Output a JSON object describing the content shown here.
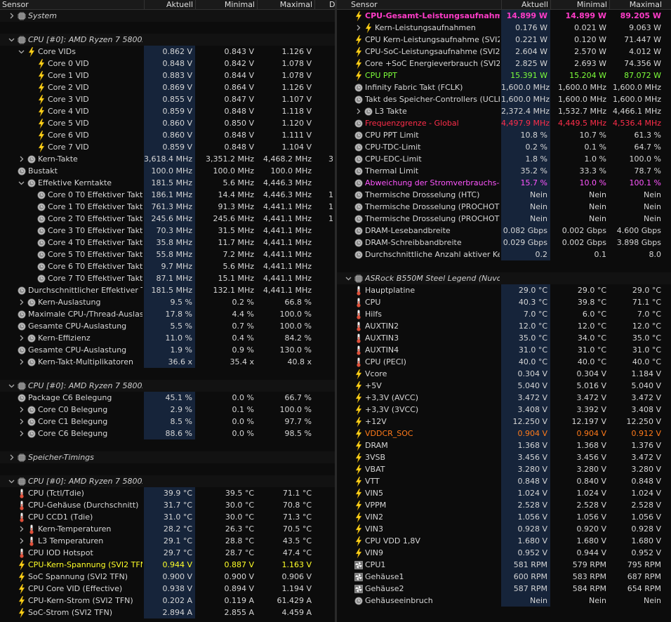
{
  "header": {
    "sensor": "Sensor",
    "current": "Aktuell",
    "min": "Minimal",
    "max": "Maximal",
    "avg": "D"
  },
  "left": [
    {
      "t": "grp",
      "exp": ">",
      "icon": "chip",
      "label": "System"
    },
    {
      "t": "blank"
    },
    {
      "t": "grp",
      "exp": "v",
      "icon": "chip",
      "label": "CPU [#0]: AMD Ryzen 7 5800X3D"
    },
    {
      "lvl": 1,
      "exp": "v",
      "icon": "bolt",
      "label": "Core VIDs",
      "v": [
        "0.862 V",
        "0.843 V",
        "1.126 V"
      ]
    },
    {
      "lvl": 2,
      "icon": "bolt",
      "label": "Core 0 VID",
      "v": [
        "0.848 V",
        "0.842 V",
        "1.078 V"
      ]
    },
    {
      "lvl": 2,
      "icon": "bolt",
      "label": "Core 1 VID",
      "v": [
        "0.883 V",
        "0.844 V",
        "1.078 V"
      ]
    },
    {
      "lvl": 2,
      "icon": "bolt",
      "label": "Core 2 VID",
      "v": [
        "0.869 V",
        "0.864 V",
        "1.126 V"
      ]
    },
    {
      "lvl": 2,
      "icon": "bolt",
      "label": "Core 3 VID",
      "v": [
        "0.855 V",
        "0.847 V",
        "1.107 V"
      ]
    },
    {
      "lvl": 2,
      "icon": "bolt",
      "label": "Core 4 VID",
      "v": [
        "0.859 V",
        "0.848 V",
        "1.118 V"
      ]
    },
    {
      "lvl": 2,
      "icon": "bolt",
      "label": "Core 5 VID",
      "v": [
        "0.860 V",
        "0.850 V",
        "1.120 V"
      ]
    },
    {
      "lvl": 2,
      "icon": "bolt",
      "label": "Core 6 VID",
      "v": [
        "0.860 V",
        "0.848 V",
        "1.111 V"
      ]
    },
    {
      "lvl": 2,
      "icon": "bolt",
      "label": "Core 7 VID",
      "v": [
        "0.859 V",
        "0.848 V",
        "1.104 V"
      ]
    },
    {
      "lvl": 1,
      "exp": ">",
      "icon": "clock",
      "label": "Kern-Takte",
      "v": [
        "3,618.4 MHz",
        "3,351.2 MHz",
        "4,468.2 MHz"
      ],
      "avg": "3"
    },
    {
      "lvl": 0,
      "icon": "clock",
      "label": "Bustakt",
      "v": [
        "100.0 MHz",
        "100.0 MHz",
        "100.0 MHz"
      ]
    },
    {
      "lvl": 1,
      "exp": "v",
      "icon": "clock",
      "label": "Effektive Kerntakte",
      "v": [
        "181.5 MHz",
        "5.6 MHz",
        "4,446.3 MHz"
      ]
    },
    {
      "lvl": 2,
      "icon": "clock",
      "label": "Core 0 T0 Effektiver Takt",
      "v": [
        "186.1 MHz",
        "14.4 MHz",
        "4,446.3 MHz"
      ],
      "avg": "1"
    },
    {
      "lvl": 2,
      "icon": "clock",
      "label": "Core 1 T0 Effektiver Takt",
      "v": [
        "761.3 MHz",
        "91.3 MHz",
        "4,441.1 MHz"
      ],
      "avg": "1"
    },
    {
      "lvl": 2,
      "icon": "clock",
      "label": "Core 2 T0 Effektiver Takt",
      "v": [
        "245.6 MHz",
        "245.6 MHz",
        "4,441.1 MHz"
      ],
      "avg": "1"
    },
    {
      "lvl": 2,
      "icon": "clock",
      "label": "Core 3 T0 Effektiver Takt",
      "v": [
        "70.3 MHz",
        "31.5 MHz",
        "4,441.1 MHz"
      ]
    },
    {
      "lvl": 2,
      "icon": "clock",
      "label": "Core 4 T0 Effektiver Takt",
      "v": [
        "35.8 MHz",
        "11.7 MHz",
        "4,441.1 MHz"
      ]
    },
    {
      "lvl": 2,
      "icon": "clock",
      "label": "Core 5 T0 Effektiver Takt",
      "v": [
        "55.8 MHz",
        "7.2 MHz",
        "4,441.1 MHz"
      ]
    },
    {
      "lvl": 2,
      "icon": "clock",
      "label": "Core 6 T0 Effektiver Takt",
      "v": [
        "9.7 MHz",
        "5.6 MHz",
        "4,441.1 MHz"
      ]
    },
    {
      "lvl": 2,
      "icon": "clock",
      "label": "Core 7 T0 Effektiver Takt",
      "v": [
        "87.1 MHz",
        "15.1 MHz",
        "4,441.1 MHz"
      ]
    },
    {
      "lvl": 0,
      "icon": "clock",
      "label": "Durchschnittlicher Effektiver Takt",
      "v": [
        "181.5 MHz",
        "132.1 MHz",
        "4,441.1 MHz"
      ]
    },
    {
      "lvl": 1,
      "exp": ">",
      "icon": "clock",
      "label": "Kern-Auslastung",
      "v": [
        "9.5 %",
        "0.2 %",
        "66.8 %"
      ]
    },
    {
      "lvl": 0,
      "icon": "clock",
      "label": "Maximale CPU-/Thread-Auslast...",
      "v": [
        "17.8 %",
        "4.4 %",
        "100.0 %"
      ]
    },
    {
      "lvl": 0,
      "icon": "clock",
      "label": "Gesamte CPU-Auslastung",
      "v": [
        "5.5 %",
        "0.7 %",
        "100.0 %"
      ]
    },
    {
      "lvl": 1,
      "exp": ">",
      "icon": "clock",
      "label": "Kern-Effizienz",
      "v": [
        "11.0 %",
        "0.4 %",
        "84.2 %"
      ]
    },
    {
      "lvl": 0,
      "icon": "clock",
      "label": "Gesamte CPU-Auslastung",
      "v": [
        "1.9 %",
        "0.9 %",
        "130.0 %"
      ]
    },
    {
      "lvl": 1,
      "exp": ">",
      "icon": "clock",
      "label": "Kern-Takt-Multiplikatoren",
      "v": [
        "36.6 x",
        "35.4 x",
        "40.8 x"
      ]
    },
    {
      "t": "blank"
    },
    {
      "t": "grp",
      "exp": "v",
      "icon": "chip",
      "label": "CPU [#0]: AMD Ryzen 7 5800X..."
    },
    {
      "lvl": 0,
      "icon": "clock",
      "label": "Package C6 Belegung",
      "v": [
        "45.1 %",
        "0.0 %",
        "66.7 %"
      ]
    },
    {
      "lvl": 1,
      "exp": ">",
      "icon": "clock",
      "label": "Core C0 Belegung",
      "v": [
        "2.9 %",
        "0.1 %",
        "100.0 %"
      ]
    },
    {
      "lvl": 1,
      "exp": ">",
      "icon": "clock",
      "label": "Core C1 Belegung",
      "v": [
        "8.5 %",
        "0.0 %",
        "97.7 %"
      ]
    },
    {
      "lvl": 1,
      "exp": ">",
      "icon": "clock",
      "label": "Core C6 Belegung",
      "v": [
        "88.6 %",
        "0.0 %",
        "98.5 %"
      ]
    },
    {
      "t": "blank"
    },
    {
      "t": "grp",
      "exp": ">",
      "icon": "chip",
      "label": "Speicher-Timings"
    },
    {
      "t": "blank"
    },
    {
      "t": "grp",
      "exp": "v",
      "icon": "chip",
      "label": "CPU [#0]: AMD Ryzen 7 5800X..."
    },
    {
      "lvl": 0,
      "icon": "therm",
      "label": "CPU (Tctl/Tdie)",
      "v": [
        "39.9 °C",
        "39.5 °C",
        "71.1 °C"
      ]
    },
    {
      "lvl": 0,
      "icon": "therm",
      "label": "CPU-Gehäuse (Durchschnitt)",
      "v": [
        "31.7 °C",
        "30.0 °C",
        "70.8 °C"
      ]
    },
    {
      "lvl": 0,
      "icon": "therm",
      "label": "CPU CCD1 (Tdie)",
      "v": [
        "31.0 °C",
        "30.0 °C",
        "71.3 °C"
      ]
    },
    {
      "lvl": 1,
      "exp": ">",
      "icon": "therm",
      "label": "Kern-Temperaturen",
      "v": [
        "28.2 °C",
        "26.3 °C",
        "70.5 °C"
      ]
    },
    {
      "lvl": 1,
      "exp": ">",
      "icon": "therm",
      "label": "L3 Temperaturen",
      "v": [
        "29.1 °C",
        "28.8 °C",
        "43.5 °C"
      ]
    },
    {
      "lvl": 0,
      "icon": "therm",
      "label": "CPU IOD Hotspot",
      "v": [
        "29.7 °C",
        "28.7 °C",
        "47.4 °C"
      ]
    },
    {
      "lvl": 0,
      "icon": "bolt",
      "label": "CPU-Kern-Spannung (SVI2 TFN)",
      "v": [
        "0.944 V",
        "0.887 V",
        "1.163 V"
      ],
      "color": "yel"
    },
    {
      "lvl": 0,
      "icon": "bolt",
      "label": "SoC Spannung (SVI2 TFN)",
      "v": [
        "0.900 V",
        "0.900 V",
        "0.906 V"
      ]
    },
    {
      "lvl": 0,
      "icon": "bolt",
      "label": "CPU Core VID (Effective)",
      "v": [
        "0.938 V",
        "0.894 V",
        "1.194 V"
      ]
    },
    {
      "lvl": 0,
      "icon": "bolt",
      "label": "CPU-Kern-Strom (SVI2 TFN)",
      "v": [
        "0.202 A",
        "0.119 A",
        "61.429 A"
      ]
    },
    {
      "lvl": 0,
      "icon": "bolt",
      "label": "SoC-Strom (SVI2 TFN)",
      "v": [
        "2.894 A",
        "2.855 A",
        "4.459 A"
      ]
    }
  ],
  "right": [
    {
      "lvl": 0,
      "icon": "bolt",
      "label": "CPU-Gesamt-Leistungsaufnahme",
      "v": [
        "14.899 W",
        "14.899 W",
        "89.205 W"
      ],
      "color": "mag",
      "bold": true
    },
    {
      "lvl": 1,
      "exp": ">",
      "icon": "bolt",
      "label": "Kern-Leistungsaufnahmen",
      "v": [
        "0.176 W",
        "0.021 W",
        "9.063 W"
      ]
    },
    {
      "lvl": 0,
      "icon": "bolt",
      "label": "CPU Kern-Leistungsaufnahme (SVI2 ...",
      "v": [
        "0.221 W",
        "0.120 W",
        "71.447 W"
      ]
    },
    {
      "lvl": 0,
      "icon": "bolt",
      "label": "CPU-SoC-Leistungsaufnahme (SVI2 T...",
      "v": [
        "2.604 W",
        "2.570 W",
        "4.012 W"
      ]
    },
    {
      "lvl": 0,
      "icon": "bolt",
      "label": "Core +SoC Energieverbrauch (SVI2 TFN)",
      "v": [
        "2.825 W",
        "2.693 W",
        "74.356 W"
      ]
    },
    {
      "lvl": 0,
      "icon": "bolt",
      "label": "CPU PPT",
      "v": [
        "15.391 W",
        "15.204 W",
        "87.072 W"
      ],
      "color": "grn"
    },
    {
      "lvl": 0,
      "icon": "clock",
      "label": "Infinity Fabric Takt (FCLK)",
      "v": [
        "1,600.0 MHz",
        "1,600.0 MHz",
        "1,600.0 MHz"
      ]
    },
    {
      "lvl": 0,
      "icon": "clock",
      "label": "Takt des Speicher-Controllers (UCLK)",
      "v": [
        "1,600.0 MHz",
        "1,600.0 MHz",
        "1,600.0 MHz"
      ]
    },
    {
      "lvl": 1,
      "exp": ">",
      "icon": "clock",
      "label": "L3 Takte",
      "v": [
        "2,372.4 MHz",
        "1,532.7 MHz",
        "4,466.1 MHz"
      ]
    },
    {
      "lvl": 0,
      "icon": "clock",
      "label": "Frequenzgrenze - Global",
      "v": [
        "4,497.9 MHz",
        "4,449.5 MHz",
        "4,536.4 MHz"
      ],
      "color": "red"
    },
    {
      "lvl": 0,
      "icon": "clock",
      "label": "CPU PPT Limit",
      "v": [
        "10.8 %",
        "10.7 %",
        "61.3 %"
      ]
    },
    {
      "lvl": 0,
      "icon": "clock",
      "label": "CPU-TDC-Limit",
      "v": [
        "0.2 %",
        "0.1 %",
        "64.7 %"
      ]
    },
    {
      "lvl": 0,
      "icon": "clock",
      "label": "CPU-EDC-Limit",
      "v": [
        "1.8 %",
        "1.0 %",
        "100.0 %"
      ]
    },
    {
      "lvl": 0,
      "icon": "clock",
      "label": "Thermal Limit",
      "v": [
        "35.2 %",
        "33.3 %",
        "78.7 %"
      ]
    },
    {
      "lvl": 0,
      "icon": "clock",
      "label": "Abweichung der Stromverbrauchs-Be...",
      "v": [
        "15.7 %",
        "10.0 %",
        "100.1 %"
      ],
      "color": "pur"
    },
    {
      "lvl": 0,
      "icon": "clock",
      "label": "Thermische Drosselung (HTC)",
      "v": [
        "Nein",
        "Nein",
        "Nein"
      ]
    },
    {
      "lvl": 0,
      "icon": "clock",
      "label": "Thermische Drosselung (PROCHOT C...",
      "v": [
        "Nein",
        "Nein",
        "Nein"
      ]
    },
    {
      "lvl": 0,
      "icon": "clock",
      "label": "Thermische Drosselung (PROCHOT E...",
      "v": [
        "Nein",
        "Nein",
        "Nein"
      ]
    },
    {
      "lvl": 0,
      "icon": "clock",
      "label": "DRAM-Lesebandbreite",
      "v": [
        "0.082 Gbps",
        "0.002 Gbps",
        "4.600 Gbps"
      ]
    },
    {
      "lvl": 0,
      "icon": "clock",
      "label": "DRAM-Schreibbandbreite",
      "v": [
        "0.029 Gbps",
        "0.002 Gbps",
        "3.898 Gbps"
      ]
    },
    {
      "lvl": 0,
      "icon": "clock",
      "label": "Durchschnittliche Anzahl aktiver Kerne",
      "v": [
        "0.2",
        "0.1",
        "8.0"
      ]
    },
    {
      "t": "blank"
    },
    {
      "t": "grp",
      "exp": "v",
      "icon": "chip",
      "label": "ASRock B550M Steel Legend (Nuvoto..."
    },
    {
      "lvl": 0,
      "icon": "therm",
      "label": "Hauptplatine",
      "v": [
        "29.0 °C",
        "29.0 °C",
        "29.0 °C"
      ]
    },
    {
      "lvl": 0,
      "icon": "therm",
      "label": "CPU",
      "v": [
        "40.3 °C",
        "39.8 °C",
        "71.1 °C"
      ]
    },
    {
      "lvl": 0,
      "icon": "therm",
      "label": "Hilfs",
      "v": [
        "7.0 °C",
        "6.0 °C",
        "7.0 °C"
      ]
    },
    {
      "lvl": 0,
      "icon": "therm",
      "label": "AUXTIN2",
      "v": [
        "12.0 °C",
        "12.0 °C",
        "12.0 °C"
      ]
    },
    {
      "lvl": 0,
      "icon": "therm",
      "label": "AUXTIN3",
      "v": [
        "35.0 °C",
        "34.0 °C",
        "35.0 °C"
      ]
    },
    {
      "lvl": 0,
      "icon": "therm",
      "label": "AUXTIN4",
      "v": [
        "31.0 °C",
        "31.0 °C",
        "31.0 °C"
      ]
    },
    {
      "lvl": 0,
      "icon": "therm",
      "label": "CPU (PECI)",
      "v": [
        "40.0 °C",
        "40.0 °C",
        "40.0 °C"
      ]
    },
    {
      "lvl": 0,
      "icon": "bolt",
      "label": "Vcore",
      "v": [
        "0.304 V",
        "0.304 V",
        "1.184 V"
      ]
    },
    {
      "lvl": 0,
      "icon": "bolt",
      "label": "+5V",
      "v": [
        "5.040 V",
        "5.016 V",
        "5.040 V"
      ]
    },
    {
      "lvl": 0,
      "icon": "bolt",
      "label": "+3,3V (AVCC)",
      "v": [
        "3.472 V",
        "3.472 V",
        "3.472 V"
      ]
    },
    {
      "lvl": 0,
      "icon": "bolt",
      "label": "+3,3V (3VCC)",
      "v": [
        "3.408 V",
        "3.392 V",
        "3.408 V"
      ]
    },
    {
      "lvl": 0,
      "icon": "bolt",
      "label": "+12V",
      "v": [
        "12.250 V",
        "12.197 V",
        "12.250 V"
      ]
    },
    {
      "lvl": 0,
      "icon": "bolt",
      "label": "VDDCR_SOC",
      "v": [
        "0.904 V",
        "0.904 V",
        "0.912 V"
      ],
      "color": "org"
    },
    {
      "lvl": 0,
      "icon": "bolt",
      "label": "DRAM",
      "v": [
        "1.368 V",
        "1.368 V",
        "1.376 V"
      ]
    },
    {
      "lvl": 0,
      "icon": "bolt",
      "label": "3VSB",
      "v": [
        "3.456 V",
        "3.456 V",
        "3.472 V"
      ]
    },
    {
      "lvl": 0,
      "icon": "bolt",
      "label": "VBAT",
      "v": [
        "3.280 V",
        "3.280 V",
        "3.280 V"
      ]
    },
    {
      "lvl": 0,
      "icon": "bolt",
      "label": "VTT",
      "v": [
        "0.848 V",
        "0.840 V",
        "0.848 V"
      ]
    },
    {
      "lvl": 0,
      "icon": "bolt",
      "label": "VIN5",
      "v": [
        "1.024 V",
        "1.024 V",
        "1.024 V"
      ]
    },
    {
      "lvl": 0,
      "icon": "bolt",
      "label": "VPPM",
      "v": [
        "2.528 V",
        "2.528 V",
        "2.528 V"
      ]
    },
    {
      "lvl": 0,
      "icon": "bolt",
      "label": "VIN2",
      "v": [
        "1.056 V",
        "1.056 V",
        "1.056 V"
      ]
    },
    {
      "lvl": 0,
      "icon": "bolt",
      "label": "VIN3",
      "v": [
        "0.928 V",
        "0.920 V",
        "0.928 V"
      ]
    },
    {
      "lvl": 0,
      "icon": "bolt",
      "label": "CPU VDD 1,8V",
      "v": [
        "1.680 V",
        "1.680 V",
        "1.680 V"
      ]
    },
    {
      "lvl": 0,
      "icon": "bolt",
      "label": "VIN9",
      "v": [
        "0.952 V",
        "0.944 V",
        "0.952 V"
      ]
    },
    {
      "lvl": 0,
      "icon": "fan",
      "label": "CPU1",
      "v": [
        "581 RPM",
        "579 RPM",
        "795 RPM"
      ]
    },
    {
      "lvl": 0,
      "icon": "fan",
      "label": "Gehäuse1",
      "v": [
        "600 RPM",
        "583 RPM",
        "687 RPM"
      ]
    },
    {
      "lvl": 0,
      "icon": "fan",
      "label": "Gehäuse2",
      "v": [
        "587 RPM",
        "584 RPM",
        "654 RPM"
      ]
    },
    {
      "lvl": 0,
      "icon": "clock",
      "label": "Gehäuseeinbruch",
      "v": [
        "Nein",
        "Nein",
        "Nein"
      ]
    }
  ]
}
